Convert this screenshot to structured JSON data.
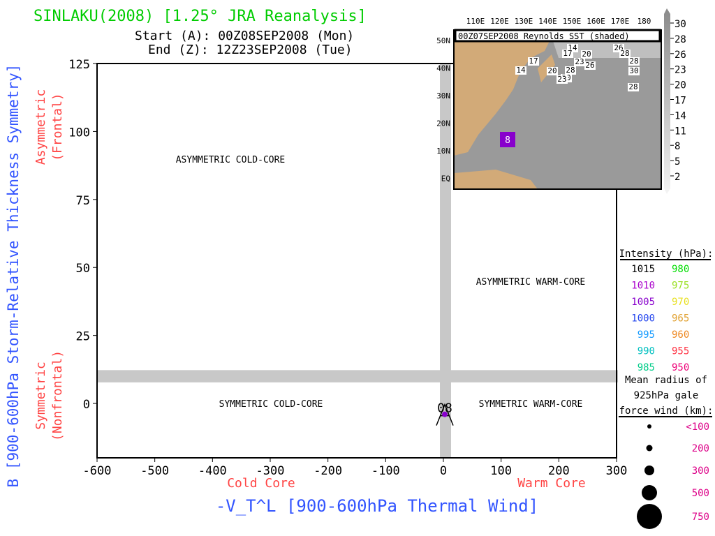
{
  "header": {
    "title": "SINLAKU(2008) [1.25° JRA Reanalysis]",
    "start": "Start (A): 00Z08SEP2008 (Mon)",
    "end": "End (Z): 12Z23SEP2008 (Tue)"
  },
  "colors": {
    "title": "#00cc00",
    "axis_label": "#3355ff",
    "core_label": "#ff4444",
    "track": "#8800cc",
    "band": "#c8c8c8"
  },
  "chart_data": {
    "type": "scatter",
    "xlabel": "-V_T^L [900-600hPa Thermal Wind]",
    "ylabel": "B [900-600hPa Storm-Relative Thickness Symmetry]",
    "xlim": [
      -600,
      300
    ],
    "ylim": [
      -20,
      125
    ],
    "xticks": [
      "-600",
      "-500",
      "-400",
      "-300",
      "-200",
      "-100",
      "0",
      "100",
      "200",
      "300"
    ],
    "xtick_values": [
      -600,
      -500,
      -400,
      -300,
      -200,
      -100,
      0,
      100,
      200,
      300
    ],
    "yticks": [
      "0",
      "25",
      "50",
      "75",
      "100",
      "125"
    ],
    "ytick_values": [
      0,
      25,
      50,
      75,
      100,
      125
    ],
    "x_side_labels": {
      "left": "Cold Core",
      "right": "Warm Core"
    },
    "y_side_labels": {
      "top": "Asymmetric\n(Frontal)",
      "top_1": "Asymmetric",
      "top_2": "(Frontal)",
      "bottom_1": "Symmetric",
      "bottom_2": "(Nonfrontal)"
    },
    "quadrants": {
      "ul": "ASYMMETRIC COLD-CORE",
      "ur": "ASYMMETRIC WARM-CORE",
      "ll": "SYMMETRIC COLD-CORE",
      "lr": "SYMMETRIC WARM-CORE"
    },
    "points": [
      {
        "x": 0,
        "y": -4,
        "label": "08",
        "marker": "A",
        "pressure": 1005
      }
    ]
  },
  "legend": {
    "intensity_title": "Intensity (hPa):",
    "intensity": [
      {
        "left": "1015",
        "lc": "#000000",
        "right": "980",
        "rc": "#00dd00"
      },
      {
        "left": "1010",
        "lc": "#aa00cc",
        "right": "975",
        "rc": "#99e020"
      },
      {
        "left": "1005",
        "lc": "#8800cc",
        "right": "970",
        "rc": "#e8e020"
      },
      {
        "left": "1000",
        "lc": "#2244ee",
        "right": "965",
        "rc": "#e0a030"
      },
      {
        "left": "995",
        "lc": "#1199ff",
        "right": "960",
        "rc": "#ee8822"
      },
      {
        "left": "990",
        "lc": "#00c0c0",
        "right": "955",
        "rc": "#ff3344"
      },
      {
        "left": "985",
        "lc": "#00cc88",
        "right": "950",
        "rc": "#ee0077"
      }
    ],
    "radius_title_1": "Mean radius of",
    "radius_title_2": "925hPa gale",
    "radius_title_3": "force wind (km):",
    "radius": [
      "<100",
      "200",
      "300",
      "500",
      "750"
    ],
    "radius_color": "#dd0088"
  },
  "inset": {
    "title": "00Z07SEP2008 Reynolds SST (shaded)",
    "lon_labels": [
      "110E",
      "120E",
      "130E",
      "140E",
      "150E",
      "160E",
      "170E",
      "180"
    ],
    "lat_labels": [
      "50N",
      "40N",
      "30N",
      "20N",
      "10N",
      "EQ"
    ],
    "colorbar": [
      "30",
      "28",
      "26",
      "23",
      "20",
      "17",
      "14",
      "11",
      "8",
      "5",
      "2"
    ],
    "contour_labels": [
      "14",
      "17",
      "20",
      "23",
      "26",
      "28",
      "30",
      "14",
      "17",
      "20",
      "23",
      "26",
      "28",
      "28",
      "30",
      "28"
    ],
    "storm_marker": "8"
  }
}
